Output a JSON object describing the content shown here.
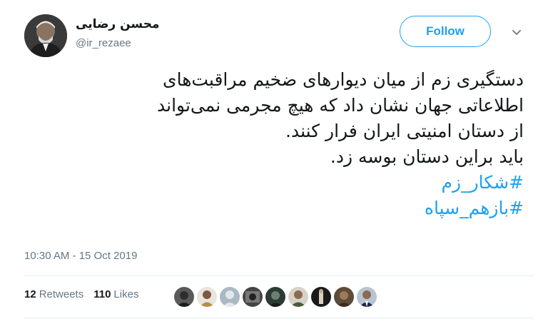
{
  "author": {
    "name": "محسن رضایی",
    "handle": "@ir_rezaee"
  },
  "follow_label": "Follow",
  "tweet_lines": [
    "دستگیری زم از میان دیوارهای ضخیم مراقبت‌های",
    "اطلاعاتی جهان نشان داد که هیچ مجرمی نمی‌تواند",
    "از دستان امنیتی ایران فرار کنند.",
    "باید براین دستان بوسه زد."
  ],
  "hashtags": [
    "#شکار_زم",
    "#بازهم_سپاه"
  ],
  "timestamp": "10:30 AM - 15 Oct 2019",
  "stats": {
    "retweets_count": "12",
    "retweets_label": "Retweets",
    "likes_count": "110",
    "likes_label": "Likes"
  },
  "colors": {
    "accent": "#1da1f2",
    "text": "#14171a",
    "muted": "#657786",
    "divider": "#e6ecf0"
  }
}
